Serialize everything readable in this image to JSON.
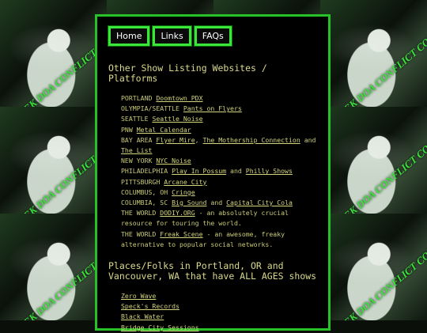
{
  "nav": {
    "home": "Home",
    "links": "Links",
    "faqs": "FAQs"
  },
  "background": {
    "stamp_text": "DEK DOA CONFLICT COLLECTIVE",
    "accent_color": "#3be23b"
  },
  "section1": {
    "title_line1": "Other Show Listing Websites /",
    "title_line2": "Platforms",
    "items": [
      {
        "prefix": "PORTLAND ",
        "links": [
          "Doomtown PDX"
        ],
        "sep": [],
        "suffix": ""
      },
      {
        "prefix": "OLYMPIA/SEATTLE ",
        "links": [
          "Pants on Flyers"
        ],
        "sep": [],
        "suffix": ""
      },
      {
        "prefix": "SEATTLE ",
        "links": [
          "Seattle Noise"
        ],
        "sep": [],
        "suffix": ""
      },
      {
        "prefix": "PNW ",
        "links": [
          "Metal Calendar"
        ],
        "sep": [],
        "suffix": ""
      },
      {
        "prefix": "BAY AREA ",
        "links": [
          "Flyer Mire",
          "The Mothership Connection",
          "The List"
        ],
        "sep": [
          ", ",
          " and "
        ],
        "suffix": ""
      },
      {
        "prefix": "NEW YORK ",
        "links": [
          "NYC Noise"
        ],
        "sep": [],
        "suffix": ""
      },
      {
        "prefix": "PHILADELPHIA ",
        "links": [
          "Play In Possum",
          "Philly Shows"
        ],
        "sep": [
          " and "
        ],
        "suffix": ""
      },
      {
        "prefix": "PITTSBURGH ",
        "links": [
          "Arcane City"
        ],
        "sep": [],
        "suffix": ""
      },
      {
        "prefix": "COLUMBUS, OH ",
        "links": [
          "Cringe"
        ],
        "sep": [],
        "suffix": ""
      },
      {
        "prefix": "COLUMBIA, SC ",
        "links": [
          "Big Sound",
          "Capital City Cola"
        ],
        "sep": [
          " and "
        ],
        "suffix": ""
      },
      {
        "prefix": "THE WORLD ",
        "links": [
          "DODIY.ORG"
        ],
        "sep": [],
        "suffix": " - an absolutely crucial resource for touring the world."
      },
      {
        "prefix": "THE WORLD ",
        "links": [
          "Freak Scene"
        ],
        "sep": [],
        "suffix": " - an awesome, freaky alternative to popular social networks."
      }
    ]
  },
  "section2": {
    "title_line1": "Places/Folks in Portland, OR and",
    "title_line2": "Vancouver, WA that have ALL AGES shows",
    "items": [
      "Zero Wave",
      "Speck's Records",
      "Black Water",
      "Bridge City Sessions"
    ]
  }
}
